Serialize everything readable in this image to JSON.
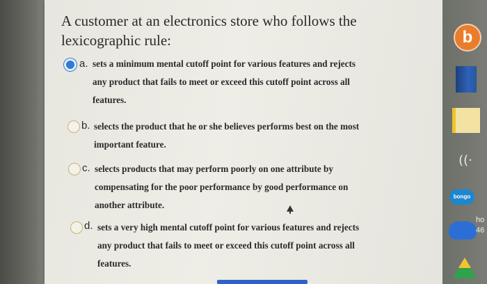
{
  "quiz": {
    "question": "A customer at an electronics store who follows the lexicographic rule:",
    "options": [
      {
        "letter": "a.",
        "lines": [
          "sets a minimum mental cutoff point for various features and rejects",
          "any product that fails to meet or exceed this cutoff point across all",
          "features."
        ],
        "selected": true
      },
      {
        "letter": "b.",
        "lines": [
          "selects the product that he or she believes performs best on the most",
          "important feature."
        ],
        "selected": false
      },
      {
        "letter": "c.",
        "lines": [
          "selects products that may perform poorly on one attribute by",
          "compensating for the poor performance by good performance on",
          "another attribute."
        ],
        "selected": false
      },
      {
        "letter": "d.",
        "lines": [
          "sets a very high mental cutoff point for various features and rejects",
          "any product that fails to meet or exceed this cutoff point across all",
          "features."
        ],
        "selected": false
      }
    ]
  },
  "dock": {
    "items": [
      {
        "name": "orange-app",
        "glyph": "b"
      },
      {
        "name": "book-app"
      },
      {
        "name": "notes-app"
      },
      {
        "name": "sound-app",
        "glyph": "((·"
      },
      {
        "name": "bongo-app",
        "glyph": "bongo"
      },
      {
        "name": "cloud-app"
      },
      {
        "name": "drive-app"
      }
    ],
    "edge_text": [
      "ho",
      "46"
    ]
  },
  "colors": {
    "selected_radio": "#2f7bd3",
    "page_background": "#eeede6",
    "dock_background": "#7a7c75"
  }
}
